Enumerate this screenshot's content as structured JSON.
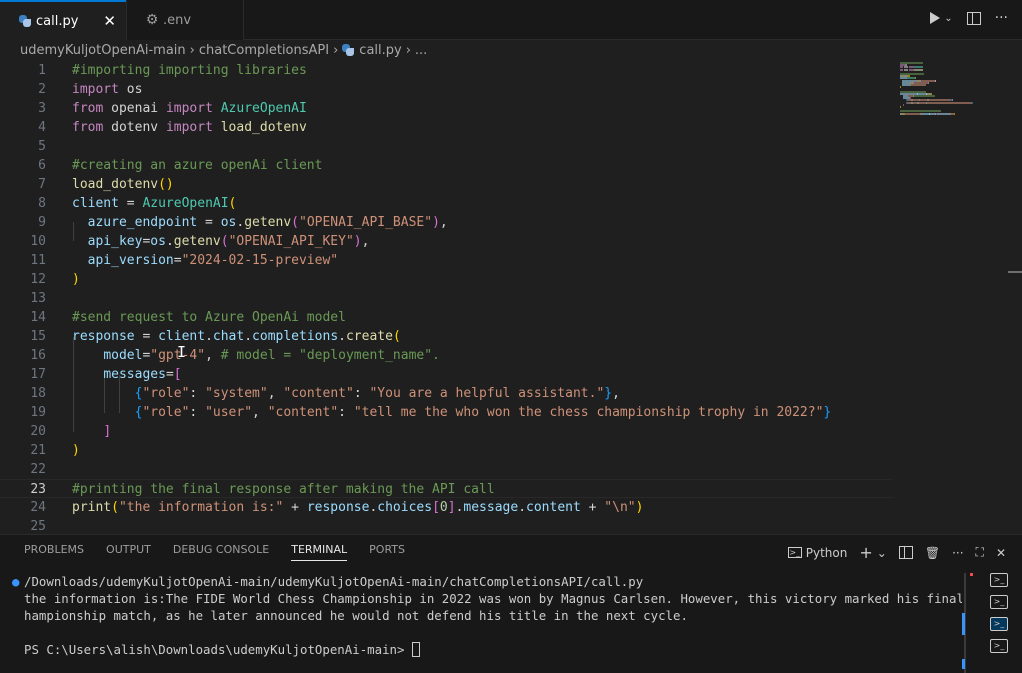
{
  "tabs": [
    {
      "label": "call.py",
      "icon": "python-icon",
      "active": true
    },
    {
      "label": ".env",
      "icon": "gear-icon",
      "active": false
    }
  ],
  "tab_close": "✕",
  "breadcrumb": {
    "items": [
      "udemyKuljotOpenAi-main",
      "chatCompletionsAPI",
      "call.py",
      "..."
    ],
    "separator": "›"
  },
  "editor": {
    "current_line": 23,
    "lines": [
      {
        "n": "1",
        "tokens": [
          [
            "cmt",
            "#importing importing libraries"
          ]
        ]
      },
      {
        "n": "2",
        "tokens": [
          [
            "kw",
            "import"
          ],
          [
            "plain",
            " "
          ],
          [
            "plain",
            "os"
          ]
        ]
      },
      {
        "n": "3",
        "tokens": [
          [
            "kw",
            "from"
          ],
          [
            "plain",
            " "
          ],
          [
            "plain",
            "openai"
          ],
          [
            "plain",
            " "
          ],
          [
            "kw",
            "import"
          ],
          [
            "plain",
            " "
          ],
          [
            "cls",
            "AzureOpenAI"
          ]
        ]
      },
      {
        "n": "4",
        "tokens": [
          [
            "kw",
            "from"
          ],
          [
            "plain",
            " "
          ],
          [
            "plain",
            "dotenv"
          ],
          [
            "plain",
            " "
          ],
          [
            "kw",
            "import"
          ],
          [
            "plain",
            " "
          ],
          [
            "fn",
            "load_dotenv"
          ]
        ]
      },
      {
        "n": "5",
        "tokens": []
      },
      {
        "n": "6",
        "tokens": [
          [
            "cmt",
            "#creating an azure openAi client"
          ]
        ]
      },
      {
        "n": "7",
        "tokens": [
          [
            "fn",
            "load_dotenv"
          ],
          [
            "p1",
            "()"
          ]
        ]
      },
      {
        "n": "8",
        "tokens": [
          [
            "var",
            "client"
          ],
          [
            "plain",
            " = "
          ],
          [
            "cls",
            "AzureOpenAI"
          ],
          [
            "p1",
            "("
          ]
        ]
      },
      {
        "n": "9",
        "tokens": [
          [
            "plain",
            "  "
          ],
          [
            "var",
            "azure_endpoint"
          ],
          [
            "plain",
            " = "
          ],
          [
            "var",
            "os"
          ],
          [
            "plain",
            "."
          ],
          [
            "fn",
            "getenv"
          ],
          [
            "p2",
            "("
          ],
          [
            "str",
            "\"OPENAI_API_BASE\""
          ],
          [
            "p2",
            ")"
          ],
          [
            "plain",
            ","
          ]
        ]
      },
      {
        "n": "10",
        "tokens": [
          [
            "plain",
            "  "
          ],
          [
            "var",
            "api_key"
          ],
          [
            "plain",
            "="
          ],
          [
            "var",
            "os"
          ],
          [
            "plain",
            "."
          ],
          [
            "fn",
            "getenv"
          ],
          [
            "p2",
            "("
          ],
          [
            "str",
            "\"OPENAI_API_KEY\""
          ],
          [
            "p2",
            ")"
          ],
          [
            "plain",
            ","
          ]
        ]
      },
      {
        "n": "11",
        "tokens": [
          [
            "plain",
            "  "
          ],
          [
            "var",
            "api_version"
          ],
          [
            "plain",
            "="
          ],
          [
            "str",
            "\"2024-02-15-preview\""
          ]
        ]
      },
      {
        "n": "12",
        "tokens": [
          [
            "p1",
            ")"
          ]
        ]
      },
      {
        "n": "13",
        "tokens": []
      },
      {
        "n": "14",
        "tokens": [
          [
            "cmt",
            "#send request to Azure OpenAi model"
          ]
        ]
      },
      {
        "n": "15",
        "tokens": [
          [
            "var",
            "response"
          ],
          [
            "plain",
            " = "
          ],
          [
            "var",
            "client"
          ],
          [
            "plain",
            "."
          ],
          [
            "var",
            "chat"
          ],
          [
            "plain",
            "."
          ],
          [
            "var",
            "completions"
          ],
          [
            "plain",
            "."
          ],
          [
            "fn",
            "create"
          ],
          [
            "p1",
            "("
          ]
        ]
      },
      {
        "n": "16",
        "tokens": [
          [
            "plain",
            "    "
          ],
          [
            "var",
            "model"
          ],
          [
            "plain",
            "="
          ],
          [
            "str",
            "\"gpt-4\""
          ],
          [
            "plain",
            ", "
          ],
          [
            "cmt",
            "# model = \"deployment_name\"."
          ]
        ]
      },
      {
        "n": "17",
        "tokens": [
          [
            "plain",
            "    "
          ],
          [
            "var",
            "messages"
          ],
          [
            "plain",
            "="
          ],
          [
            "p2",
            "["
          ]
        ]
      },
      {
        "n": "18",
        "tokens": [
          [
            "plain",
            "        "
          ],
          [
            "p3",
            "{"
          ],
          [
            "str",
            "\"role\""
          ],
          [
            "plain",
            ": "
          ],
          [
            "str",
            "\"system\""
          ],
          [
            "plain",
            ", "
          ],
          [
            "str",
            "\"content\""
          ],
          [
            "plain",
            ": "
          ],
          [
            "str",
            "\"You are a helpful assistant.\""
          ],
          [
            "p3",
            "}"
          ],
          [
            "plain",
            ","
          ]
        ]
      },
      {
        "n": "19",
        "tokens": [
          [
            "plain",
            "        "
          ],
          [
            "p3",
            "{"
          ],
          [
            "str",
            "\"role\""
          ],
          [
            "plain",
            ": "
          ],
          [
            "str",
            "\"user\""
          ],
          [
            "plain",
            ", "
          ],
          [
            "str",
            "\"content\""
          ],
          [
            "plain",
            ": "
          ],
          [
            "str",
            "\"tell me the who won the chess championship trophy in 2022?\""
          ],
          [
            "p3",
            "}"
          ]
        ]
      },
      {
        "n": "20",
        "tokens": [
          [
            "plain",
            "    "
          ],
          [
            "p2",
            "]"
          ]
        ]
      },
      {
        "n": "21",
        "tokens": [
          [
            "p1",
            ")"
          ]
        ]
      },
      {
        "n": "22",
        "tokens": []
      },
      {
        "n": "23",
        "tokens": [
          [
            "cmt",
            "#printing the final response after making the API call"
          ]
        ]
      },
      {
        "n": "24",
        "tokens": [
          [
            "fn",
            "print"
          ],
          [
            "p1",
            "("
          ],
          [
            "str",
            "\"the information is:\""
          ],
          [
            "plain",
            " + "
          ],
          [
            "var",
            "response"
          ],
          [
            "plain",
            "."
          ],
          [
            "var",
            "choices"
          ],
          [
            "p2",
            "["
          ],
          [
            "num",
            "0"
          ],
          [
            "p2",
            "]"
          ],
          [
            "plain",
            "."
          ],
          [
            "var",
            "message"
          ],
          [
            "plain",
            "."
          ],
          [
            "var",
            "content"
          ],
          [
            "plain",
            " + "
          ],
          [
            "str",
            "\"\\n\""
          ],
          [
            "p1",
            ")"
          ]
        ]
      },
      {
        "n": "25",
        "tokens": []
      }
    ]
  },
  "panel": {
    "tabs": [
      "PROBLEMS",
      "OUTPUT",
      "DEBUG CONSOLE",
      "TERMINAL",
      "PORTS"
    ],
    "active_tab": "TERMINAL",
    "shell": "Python",
    "add": "+",
    "more": "···",
    "close": "✕"
  },
  "terminal": {
    "lines": [
      "/Downloads/udemyKuljotOpenAi-main/udemyKuljotOpenAi-main/chatCompletionsAPI/call.py",
      "the information is:The FIDE World Chess Championship in 2022 was won by Magnus Carlsen. However, this victory marked his final world c",
      "hampionship match, as he later announced he would not defend his title in the next cycle.",
      "",
      "PS C:\\Users\\alish\\Downloads\\udemyKuljotOpenAi-main> "
    ]
  },
  "colors": {
    "accent": "#0078d4",
    "editor_bg": "#1f1f1f",
    "panel_bg": "#181818",
    "comment": "#6a9955",
    "keyword": "#c586c0",
    "string": "#ce9178"
  }
}
